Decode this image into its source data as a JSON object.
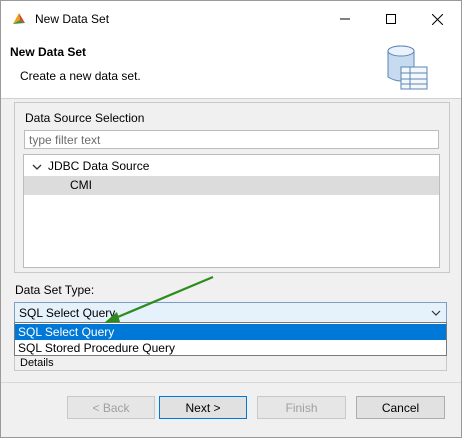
{
  "window": {
    "title": "New Data Set",
    "controls": {
      "minimize": "minimize",
      "maximize": "maximize",
      "close": "close"
    }
  },
  "banner": {
    "title": "New Data Set",
    "description": "Create a new data set."
  },
  "data_source_selection": {
    "label": "Data Source Selection",
    "filter_placeholder": "type filter text",
    "filter_value": "",
    "tree": [
      {
        "label": "JDBC Data Source",
        "expanded": true
      },
      {
        "label": "CMI",
        "selected": true
      }
    ]
  },
  "data_set_type": {
    "label": "Data Set Type:",
    "selected": "SQL Select Query",
    "options": [
      "SQL Select Query",
      "SQL Stored Procedure Query"
    ]
  },
  "details_label": "Details",
  "buttons": {
    "back": "< Back",
    "next": "Next >",
    "finish": "Finish",
    "cancel": "Cancel"
  },
  "colors": {
    "selection_blue": "#0078d7",
    "annotation_arrow": "#2e8b1e"
  }
}
